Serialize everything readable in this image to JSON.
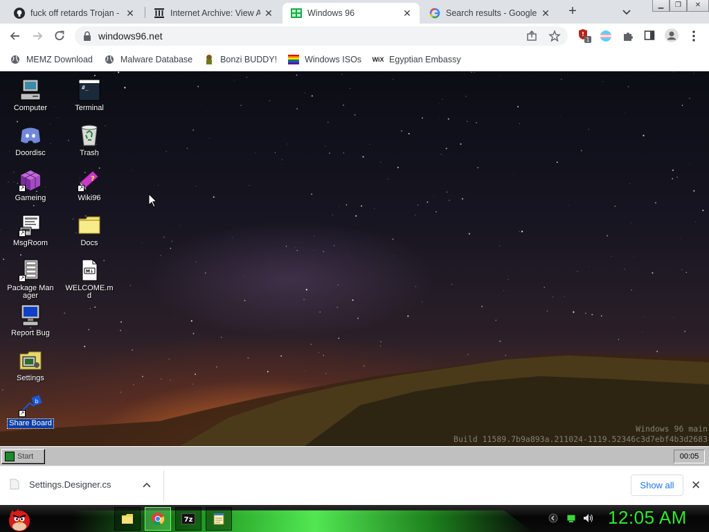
{
  "browser": {
    "tabs": [
      {
        "title": "fuck off retards Trojan - D",
        "icon": "github-icon",
        "active": false
      },
      {
        "title": "Internet Archive: View Ar",
        "icon": "archive-icon",
        "active": false
      },
      {
        "title": "Windows 96",
        "icon": "windows96-icon",
        "active": true
      },
      {
        "title": "Search results - Google C",
        "icon": "google-icon",
        "active": false
      }
    ],
    "url": "windows96.net",
    "bookmarks": [
      {
        "label": "MEMZ Download",
        "icon": "globe-icon"
      },
      {
        "label": "Malware Database",
        "icon": "globe-icon"
      },
      {
        "label": "Bonzi BUDDY!",
        "icon": "bonzi-icon"
      },
      {
        "label": "Windows ISOs",
        "icon": "rainbow-flag-icon"
      },
      {
        "label": "Egyptian Embassy",
        "icon": "wix-icon"
      }
    ],
    "extension_badge": "1"
  },
  "desktop": {
    "icons": [
      {
        "label": "Computer",
        "icon": "computer-icon"
      },
      {
        "label": "Terminal",
        "icon": "terminal-icon"
      },
      {
        "label": "Doordisc",
        "icon": "discord-icon"
      },
      {
        "label": "Trash",
        "icon": "trash-icon"
      },
      {
        "label": "Gameing",
        "icon": "cube-icon"
      },
      {
        "label": "Wiki96",
        "icon": "book-icon"
      },
      {
        "label": "MsgRoom",
        "icon": "msgroom-icon"
      },
      {
        "label": "Docs",
        "icon": "folder-icon"
      },
      {
        "label": "Package Manager",
        "icon": "package-icon"
      },
      {
        "label": "WELCOME.md",
        "icon": "markdown-file-icon"
      },
      {
        "label": "Report Bug",
        "icon": "monitor-icon"
      },
      {
        "label": "Settings",
        "icon": "settings-icon"
      },
      {
        "label": "Share Board",
        "icon": "share-icon",
        "selected": true
      }
    ],
    "watermark_line1": "Windows 96 main",
    "watermark_line2": "Build 11589.7b9a893a.211024-1119.52346c3d7ebf4b3d2683"
  },
  "w96_taskbar": {
    "start_label": "Start",
    "clock": "00:05"
  },
  "downloads": {
    "file": "Settings.Designer.cs",
    "show_all": "Show all"
  },
  "os_taskbar": {
    "clock": "12:05 AM",
    "pinned": [
      "file-explorer-icon",
      "chrome-icon",
      "7zip-icon",
      "notepad-icon"
    ]
  }
}
